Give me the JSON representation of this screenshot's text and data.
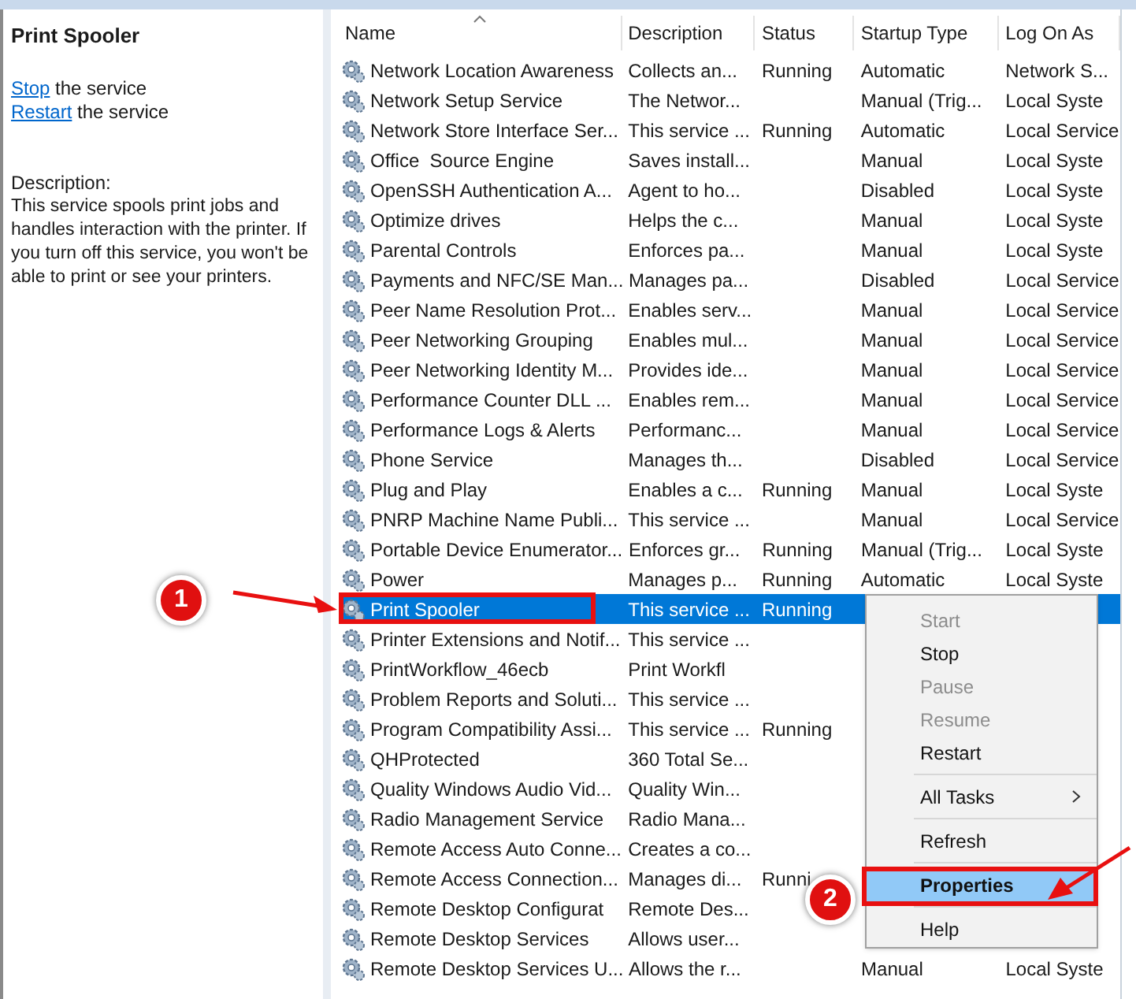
{
  "details": {
    "title": "Print Spooler",
    "actions": [
      {
        "link": "Stop",
        "rest": " the service"
      },
      {
        "link": "Restart",
        "rest": " the service"
      }
    ],
    "description_label": "Description:",
    "description": "This service spools print jobs and handles interaction with the printer. If you turn off this service, you won't be able to print or see your printers."
  },
  "table": {
    "columns": [
      "Name",
      "Description",
      "Status",
      "Startup Type",
      "Log On As"
    ],
    "rows": [
      {
        "name": "Network Location Awareness",
        "description": "Collects an...",
        "status": "Running",
        "startup": "Automatic",
        "logon": "Network S...",
        "selected": false
      },
      {
        "name": "Network Setup Service",
        "description": "The Networ...",
        "status": "",
        "startup": "Manual (Trig...",
        "logon": "Local Syste",
        "selected": false
      },
      {
        "name": "Network Store Interface Ser...",
        "description": "This service ...",
        "status": "Running",
        "startup": "Automatic",
        "logon": "Local Service",
        "selected": false
      },
      {
        "name": "Office  Source Engine",
        "description": "Saves install...",
        "status": "",
        "startup": "Manual",
        "logon": "Local Syste",
        "selected": false
      },
      {
        "name": "OpenSSH Authentication A...",
        "description": "Agent to ho...",
        "status": "",
        "startup": "Disabled",
        "logon": "Local Syste",
        "selected": false
      },
      {
        "name": "Optimize drives",
        "description": "Helps the c...",
        "status": "",
        "startup": "Manual",
        "logon": "Local Syste",
        "selected": false
      },
      {
        "name": "Parental Controls",
        "description": "Enforces pa...",
        "status": "",
        "startup": "Manual",
        "logon": "Local Syste",
        "selected": false
      },
      {
        "name": "Payments and NFC/SE Man...",
        "description": "Manages pa...",
        "status": "",
        "startup": "Disabled",
        "logon": "Local Service",
        "selected": false
      },
      {
        "name": "Peer Name Resolution Prot...",
        "description": "Enables serv...",
        "status": "",
        "startup": "Manual",
        "logon": "Local Service",
        "selected": false
      },
      {
        "name": "Peer Networking Grouping",
        "description": "Enables mul...",
        "status": "",
        "startup": "Manual",
        "logon": "Local Service",
        "selected": false
      },
      {
        "name": "Peer Networking Identity M...",
        "description": "Provides ide...",
        "status": "",
        "startup": "Manual",
        "logon": "Local Service",
        "selected": false
      },
      {
        "name": "Performance Counter DLL ...",
        "description": "Enables rem...",
        "status": "",
        "startup": "Manual",
        "logon": "Local Service",
        "selected": false
      },
      {
        "name": "Performance Logs & Alerts",
        "description": "Performanc...",
        "status": "",
        "startup": "Manual",
        "logon": "Local Service",
        "selected": false
      },
      {
        "name": "Phone Service",
        "description": "Manages th...",
        "status": "",
        "startup": "Disabled",
        "logon": "Local Service",
        "selected": false
      },
      {
        "name": "Plug and Play",
        "description": "Enables a c...",
        "status": "Running",
        "startup": "Manual",
        "logon": "Local Syste",
        "selected": false
      },
      {
        "name": "PNRP Machine Name Publi...",
        "description": "This service ...",
        "status": "",
        "startup": "Manual",
        "logon": "Local Service",
        "selected": false
      },
      {
        "name": "Portable Device Enumerator...",
        "description": "Enforces gr...",
        "status": "Running",
        "startup": "Manual (Trig...",
        "logon": "Local Syste",
        "selected": false
      },
      {
        "name": "Power",
        "description": "Manages p...",
        "status": "Running",
        "startup": "Automatic",
        "logon": "Local Syste",
        "selected": false
      },
      {
        "name": "Print Spooler",
        "description": "This service ...",
        "status": "Running",
        "startup": "",
        "logon": "",
        "selected": true
      },
      {
        "name": "Printer Extensions and Notif...",
        "description": "This service ...",
        "status": "",
        "startup": "",
        "logon": "",
        "selected": false
      },
      {
        "name": "PrintWorkflow_46ecb",
        "description": "Print Workfl",
        "status": "",
        "startup": "",
        "logon": "",
        "selected": false
      },
      {
        "name": "Problem Reports and Soluti...",
        "description": "This service ...",
        "status": "",
        "startup": "",
        "logon": "",
        "selected": false
      },
      {
        "name": "Program Compatibility Assi...",
        "description": "This service ...",
        "status": "Running",
        "startup": "",
        "logon": "",
        "selected": false
      },
      {
        "name": "QHProtected",
        "description": "360 Total Se...",
        "status": "",
        "startup": "",
        "logon": "",
        "selected": false
      },
      {
        "name": "Quality Windows Audio Vid...",
        "description": "Quality Win...",
        "status": "",
        "startup": "",
        "logon": "",
        "selected": false
      },
      {
        "name": "Radio Management Service",
        "description": "Radio Mana...",
        "status": "",
        "startup": "",
        "logon": "",
        "selected": false
      },
      {
        "name": "Remote Access Auto Conne...",
        "description": "Creates a co...",
        "status": "",
        "startup": "",
        "logon": "",
        "selected": false
      },
      {
        "name": "Remote Access Connection...",
        "description": "Manages di...",
        "status": "Runni",
        "startup": "",
        "logon": "",
        "selected": false
      },
      {
        "name": "Remote Desktop Configurat",
        "description": "Remote Des...",
        "status": "",
        "startup": "",
        "logon": "",
        "selected": false
      },
      {
        "name": "Remote Desktop Services",
        "description": "Allows user...",
        "status": "",
        "startup": "",
        "logon": "",
        "selected": false
      },
      {
        "name": "Remote Desktop Services U...",
        "description": "Allows the r...",
        "status": "",
        "startup": "Manual",
        "logon": "Local Syste",
        "selected": false
      }
    ]
  },
  "context_menu": {
    "items": [
      {
        "kind": "item",
        "label": "Start",
        "disabled": true,
        "selected": false
      },
      {
        "kind": "item",
        "label": "Stop",
        "disabled": false,
        "selected": false
      },
      {
        "kind": "item",
        "label": "Pause",
        "disabled": true,
        "selected": false
      },
      {
        "kind": "item",
        "label": "Resume",
        "disabled": true,
        "selected": false
      },
      {
        "kind": "item",
        "label": "Restart",
        "disabled": false,
        "selected": false
      },
      {
        "kind": "separator"
      },
      {
        "kind": "submenu",
        "label": "All Tasks",
        "disabled": false,
        "selected": false
      },
      {
        "kind": "separator"
      },
      {
        "kind": "item",
        "label": "Refresh",
        "disabled": false,
        "selected": false
      },
      {
        "kind": "separator"
      },
      {
        "kind": "item",
        "label": "Properties",
        "disabled": false,
        "selected": true
      },
      {
        "kind": "separator"
      },
      {
        "kind": "item",
        "label": "Help",
        "disabled": false,
        "selected": false
      }
    ]
  },
  "annotations": [
    {
      "label": "1"
    },
    {
      "label": "2"
    }
  ]
}
